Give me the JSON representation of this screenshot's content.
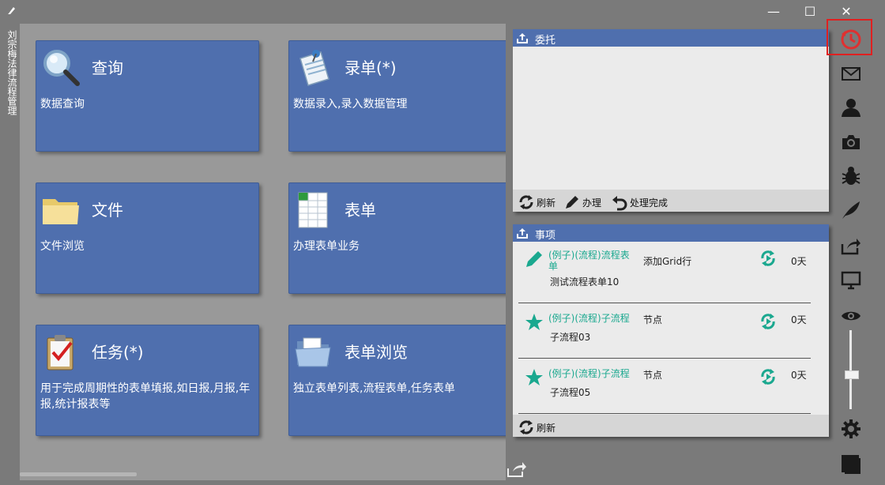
{
  "window": {
    "app_icon": "pen-icon",
    "minimize": "—",
    "maximize": "☐",
    "close": "✕",
    "side_title": "刘宗梅法律流程管理"
  },
  "tiles": [
    {
      "name": "查询",
      "desc": "数据查询",
      "icon": "magnifier-icon"
    },
    {
      "name": "录单(*)",
      "desc": "数据录入,录入数据管理",
      "icon": "document-pin-icon"
    },
    {
      "name": "文件",
      "desc": "文件浏览",
      "icon": "folder-icon"
    },
    {
      "name": "表单",
      "desc": "办理表单业务",
      "icon": "spreadsheet-icon"
    },
    {
      "name": "任务(*)",
      "desc": "用于完成周期性的表单填报,如日报,月报,年报,统计报表等",
      "icon": "clipboard-check-icon"
    },
    {
      "name": "表单浏览",
      "desc": "独立表单列表,流程表单,任务表单",
      "icon": "open-folder-icon"
    }
  ],
  "delegate_panel": {
    "title": "委托",
    "footer": {
      "refresh": "刷新",
      "handle": "办理",
      "done": "处理完成"
    }
  },
  "tasks_panel": {
    "title": "事项",
    "rows": [
      {
        "title": "(例子)(流程)流程表单",
        "step": "添加Grid行",
        "sub": "测试流程表单10",
        "days": "0天",
        "icon": "pencil-icon"
      },
      {
        "title": "(例子)(流程)子流程",
        "step": "节点",
        "sub": "子流程03",
        "days": "0天",
        "icon": "star-icon"
      },
      {
        "title": "(例子)(流程)子流程",
        "step": "节点",
        "sub": "子流程05",
        "days": "0天",
        "icon": "star-icon"
      }
    ],
    "footer": {
      "refresh": "刷新"
    }
  },
  "toolbar": {
    "items": [
      "history-icon",
      "mail-icon",
      "user-icon",
      "camera-icon",
      "bug-icon",
      "feather-icon",
      "share-icon",
      "monitor-icon",
      "eye-icon",
      "gear-icon",
      "theme-icon"
    ],
    "highlight_color": "#e02020"
  },
  "colors": {
    "tile": "#4f6fae",
    "accent_teal": "#1aa88f",
    "background": "#7a7a7a"
  }
}
